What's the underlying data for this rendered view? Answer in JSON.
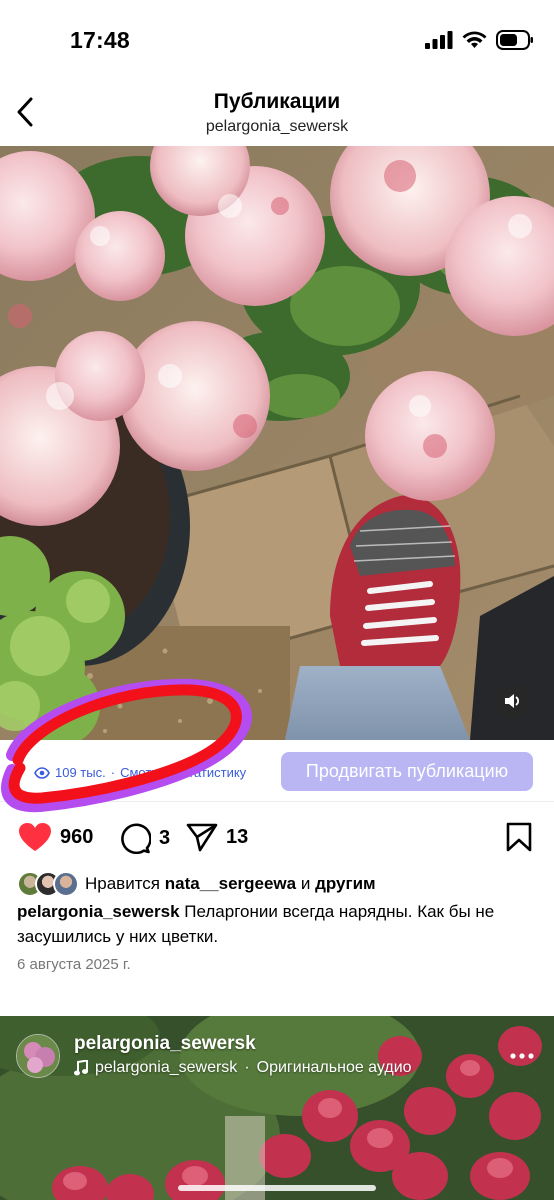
{
  "status": {
    "time": "17:48"
  },
  "header": {
    "title": "Публикации",
    "subtitle": "pelargonia_sewersk"
  },
  "post": {
    "insights": {
      "views": "109 тыс.",
      "separator": "·",
      "stats_link": "Смотреть статистику"
    },
    "promote_label": "Продвигать публикацию",
    "likes": "960",
    "comments": "3",
    "shares": "13",
    "liked_by": {
      "prefix": "Нравится",
      "user": "nata__sergeewa",
      "conj": "и",
      "others": "другим"
    },
    "caption": {
      "username": "pelargonia_sewersk",
      "text": "Пеларгонии всегда нарядны. Как бы не засушились у них цветки."
    },
    "date": "6 августа 2025 г."
  },
  "post2": {
    "username": "pelargonia_sewersk",
    "audio": {
      "user": "pelargonia_sewersk",
      "separator": "·",
      "label": "Оригинальное аудио"
    }
  },
  "colors": {
    "like_red": "#ff3040",
    "promote_button": "#b9b6f3",
    "link_blue": "#3b5bdb",
    "annotation_red": "#f2101a",
    "annotation_purple": "#b54cf0"
  },
  "icons": [
    "back-chevron",
    "signal",
    "wifi",
    "battery",
    "eye",
    "speaker",
    "heart-filled",
    "comment",
    "send",
    "bookmark",
    "music-note",
    "more-dots"
  ]
}
